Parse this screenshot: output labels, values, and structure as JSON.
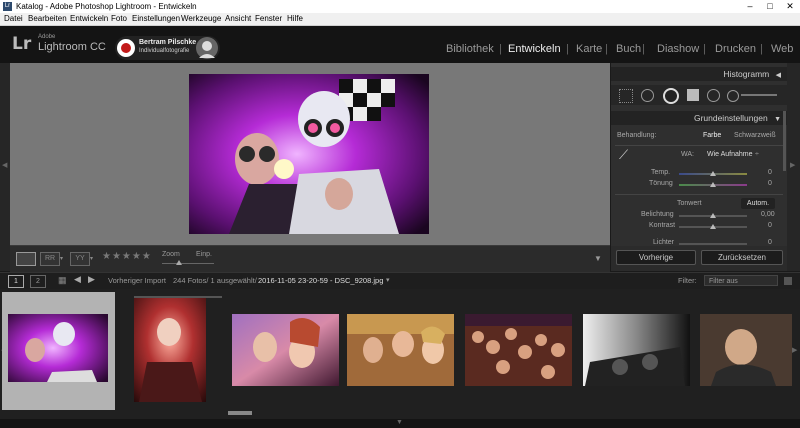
{
  "window": {
    "title": "Katalog - Adobe Photoshop Lightroom - Entwickeln",
    "icon_label": "Lr",
    "controls": [
      "–",
      "□",
      "✕"
    ]
  },
  "menu": [
    "Datei",
    "Bearbeiten",
    "Entwickeln",
    "Foto",
    "Einstellungen",
    "Werkzeuge",
    "Ansicht",
    "Fenster",
    "Hilfe"
  ],
  "identity": {
    "logo": "Lr",
    "adobe": "Adobe",
    "product": "Lightroom CC",
    "plate_name": "Bertram Pilschke",
    "plate_sub": "Individualfotografie"
  },
  "modules": [
    "Bibliothek",
    "Entwickeln",
    "Karte",
    "Buch",
    "Diashow",
    "Drucken",
    "Web"
  ],
  "active_module": "Entwickeln",
  "toolbar": {
    "zoom_label": "Zoom",
    "zoom_value": "Einp.",
    "stars": "★★★★★"
  },
  "histogram": {
    "title": "Histogramm"
  },
  "basic": {
    "title": "Grundeinstellungen",
    "treatment_label": "Behandlung:",
    "treatment_color": "Farbe",
    "treatment_bw": "Schwarzweiß",
    "wb_label": "WA:",
    "wb_value": "Wie Aufnahme",
    "temp_label": "Temp.",
    "temp_value": "0",
    "tint_label": "Tönung",
    "tint_value": "0",
    "tone_label": "Tonwert",
    "auto_label": "Autom.",
    "exposure_label": "Belichtung",
    "exposure_value": "0,00",
    "contrast_label": "Kontrast",
    "contrast_value": "0",
    "highlights_label": "Lichter",
    "highlights_value": "0"
  },
  "panel_buttons": {
    "previous": "Vorherige",
    "reset": "Zurücksetzen"
  },
  "filmstrip_bar": {
    "view1": "1",
    "view2": "2",
    "source": "Vorheriger Import",
    "count": "244 Fotos/ 1 ausgewählt/",
    "filename": "2016-11-05 23-20-59 - DSC_9208.jpg",
    "filter_label": "Filter:",
    "filter_value": "Filter aus"
  },
  "colors": {
    "background": "#787878",
    "panel": "#2f2f2f",
    "selected_cell": "#b3b3b3"
  }
}
